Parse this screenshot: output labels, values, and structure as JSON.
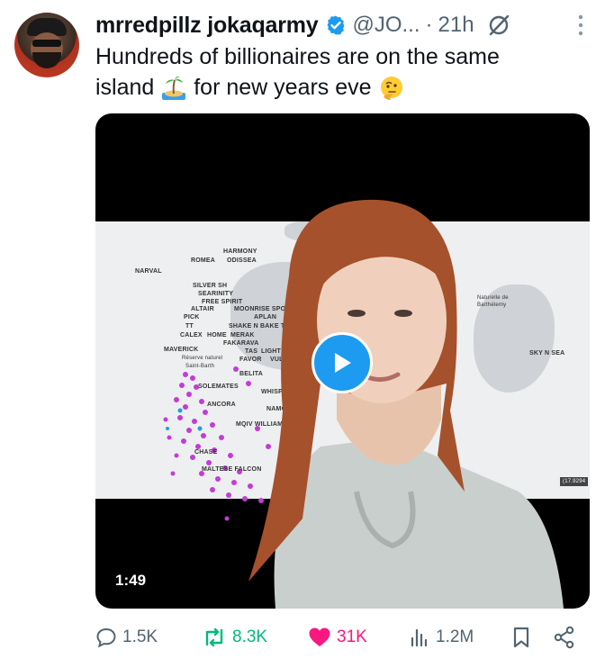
{
  "tweet": {
    "author_name": "mrredpillz jokaqarmy",
    "handle": "@JO...",
    "separator": "·",
    "time": "21h",
    "text_line1": "Hundreds of billionaires are on the same",
    "text_line2_a": "island",
    "text_line2_b": "for new years eve",
    "emoji_1": "island-emoji",
    "emoji_2": "thinking-face-emoji"
  },
  "media": {
    "duration": "1:49",
    "map_labels": {
      "harmony": "HARMONY",
      "romea": "ROMEA",
      "odissea": "ODISSEA",
      "narval": "NARVAL",
      "silver_sh": "SILVER SH",
      "searinity": "SEARINITY",
      "free_spirit": "FREE SPIRIT",
      "altair": "ALTAIR",
      "moonrise": "MOONRISE SPOR",
      "pick": "PICK",
      "aplan": "APLAN",
      "tt": "TT",
      "shake": "SHAKE N BAKE TE",
      "calex": "CALEX",
      "home": "HOME",
      "merak": "MERAK",
      "fakarava": "FAKARAVA",
      "maverick": "MAVERICK",
      "tas": "TAS",
      "light": "LIGHT",
      "reserve": "Réserve naturel",
      "favor": "FAVOR",
      "vulca": "VULCA",
      "saint": "Saint-Barth",
      "solemates": "SOLEMATES",
      "belita": "BELITA",
      "whisper": "WHISPER",
      "ancora": "ANCORA",
      "namoral": "NAMORAL",
      "moiv": "MQIV WILLIAMSAH",
      "chase": "CHASE",
      "maltese": "MALTESE FALCON",
      "naturelle": "Naturelle de",
      "barthelemy": "Barthélemy",
      "sky": "SKY N SEA",
      "coord": "(17.9294"
    }
  },
  "actions": {
    "replies": "1.5K",
    "reposts": "8.3K",
    "likes": "31K",
    "views": "1.2M"
  },
  "colors": {
    "accent": "#1d9bf0",
    "repost": "#00ba7c",
    "like": "#f91880",
    "muted": "#536471",
    "map_marker": "#c13cd6"
  }
}
